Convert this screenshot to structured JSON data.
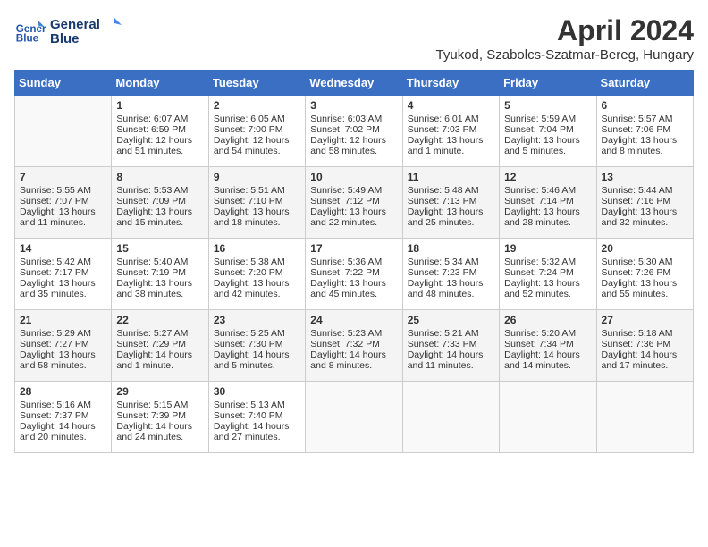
{
  "header": {
    "logo_line1": "General",
    "logo_line2": "Blue",
    "month": "April 2024",
    "location": "Tyukod, Szabolcs-Szatmar-Bereg, Hungary"
  },
  "weekdays": [
    "Sunday",
    "Monday",
    "Tuesday",
    "Wednesday",
    "Thursday",
    "Friday",
    "Saturday"
  ],
  "weeks": [
    [
      {
        "day": "",
        "info": ""
      },
      {
        "day": "1",
        "info": "Sunrise: 6:07 AM\nSunset: 6:59 PM\nDaylight: 12 hours\nand 51 minutes."
      },
      {
        "day": "2",
        "info": "Sunrise: 6:05 AM\nSunset: 7:00 PM\nDaylight: 12 hours\nand 54 minutes."
      },
      {
        "day": "3",
        "info": "Sunrise: 6:03 AM\nSunset: 7:02 PM\nDaylight: 12 hours\nand 58 minutes."
      },
      {
        "day": "4",
        "info": "Sunrise: 6:01 AM\nSunset: 7:03 PM\nDaylight: 13 hours\nand 1 minute."
      },
      {
        "day": "5",
        "info": "Sunrise: 5:59 AM\nSunset: 7:04 PM\nDaylight: 13 hours\nand 5 minutes."
      },
      {
        "day": "6",
        "info": "Sunrise: 5:57 AM\nSunset: 7:06 PM\nDaylight: 13 hours\nand 8 minutes."
      }
    ],
    [
      {
        "day": "7",
        "info": "Sunrise: 5:55 AM\nSunset: 7:07 PM\nDaylight: 13 hours\nand 11 minutes."
      },
      {
        "day": "8",
        "info": "Sunrise: 5:53 AM\nSunset: 7:09 PM\nDaylight: 13 hours\nand 15 minutes."
      },
      {
        "day": "9",
        "info": "Sunrise: 5:51 AM\nSunset: 7:10 PM\nDaylight: 13 hours\nand 18 minutes."
      },
      {
        "day": "10",
        "info": "Sunrise: 5:49 AM\nSunset: 7:12 PM\nDaylight: 13 hours\nand 22 minutes."
      },
      {
        "day": "11",
        "info": "Sunrise: 5:48 AM\nSunset: 7:13 PM\nDaylight: 13 hours\nand 25 minutes."
      },
      {
        "day": "12",
        "info": "Sunrise: 5:46 AM\nSunset: 7:14 PM\nDaylight: 13 hours\nand 28 minutes."
      },
      {
        "day": "13",
        "info": "Sunrise: 5:44 AM\nSunset: 7:16 PM\nDaylight: 13 hours\nand 32 minutes."
      }
    ],
    [
      {
        "day": "14",
        "info": "Sunrise: 5:42 AM\nSunset: 7:17 PM\nDaylight: 13 hours\nand 35 minutes."
      },
      {
        "day": "15",
        "info": "Sunrise: 5:40 AM\nSunset: 7:19 PM\nDaylight: 13 hours\nand 38 minutes."
      },
      {
        "day": "16",
        "info": "Sunrise: 5:38 AM\nSunset: 7:20 PM\nDaylight: 13 hours\nand 42 minutes."
      },
      {
        "day": "17",
        "info": "Sunrise: 5:36 AM\nSunset: 7:22 PM\nDaylight: 13 hours\nand 45 minutes."
      },
      {
        "day": "18",
        "info": "Sunrise: 5:34 AM\nSunset: 7:23 PM\nDaylight: 13 hours\nand 48 minutes."
      },
      {
        "day": "19",
        "info": "Sunrise: 5:32 AM\nSunset: 7:24 PM\nDaylight: 13 hours\nand 52 minutes."
      },
      {
        "day": "20",
        "info": "Sunrise: 5:30 AM\nSunset: 7:26 PM\nDaylight: 13 hours\nand 55 minutes."
      }
    ],
    [
      {
        "day": "21",
        "info": "Sunrise: 5:29 AM\nSunset: 7:27 PM\nDaylight: 13 hours\nand 58 minutes."
      },
      {
        "day": "22",
        "info": "Sunrise: 5:27 AM\nSunset: 7:29 PM\nDaylight: 14 hours\nand 1 minute."
      },
      {
        "day": "23",
        "info": "Sunrise: 5:25 AM\nSunset: 7:30 PM\nDaylight: 14 hours\nand 5 minutes."
      },
      {
        "day": "24",
        "info": "Sunrise: 5:23 AM\nSunset: 7:32 PM\nDaylight: 14 hours\nand 8 minutes."
      },
      {
        "day": "25",
        "info": "Sunrise: 5:21 AM\nSunset: 7:33 PM\nDaylight: 14 hours\nand 11 minutes."
      },
      {
        "day": "26",
        "info": "Sunrise: 5:20 AM\nSunset: 7:34 PM\nDaylight: 14 hours\nand 14 minutes."
      },
      {
        "day": "27",
        "info": "Sunrise: 5:18 AM\nSunset: 7:36 PM\nDaylight: 14 hours\nand 17 minutes."
      }
    ],
    [
      {
        "day": "28",
        "info": "Sunrise: 5:16 AM\nSunset: 7:37 PM\nDaylight: 14 hours\nand 20 minutes."
      },
      {
        "day": "29",
        "info": "Sunrise: 5:15 AM\nSunset: 7:39 PM\nDaylight: 14 hours\nand 24 minutes."
      },
      {
        "day": "30",
        "info": "Sunrise: 5:13 AM\nSunset: 7:40 PM\nDaylight: 14 hours\nand 27 minutes."
      },
      {
        "day": "",
        "info": ""
      },
      {
        "day": "",
        "info": ""
      },
      {
        "day": "",
        "info": ""
      },
      {
        "day": "",
        "info": ""
      }
    ]
  ]
}
